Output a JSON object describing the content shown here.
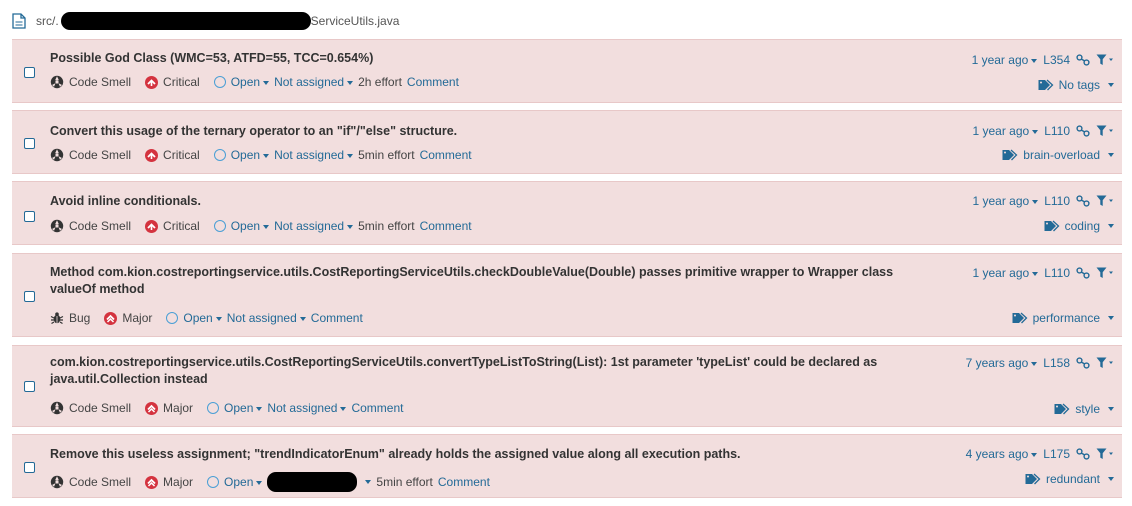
{
  "file": {
    "prefix": "src/.",
    "suffix": "ServiceUtils.java"
  },
  "issues": [
    {
      "title": "Possible God Class (WMC=53, ATFD=55, TCC=0.654%)",
      "type": "Code Smell",
      "severity": "Critical",
      "status": "Open",
      "assignee": "Not assigned",
      "effort": "2h effort",
      "comment": "Comment",
      "age": "1 year ago",
      "line": "L354",
      "tag": "No tags"
    },
    {
      "title": "Convert this usage of the ternary operator to an \"if\"/\"else\" structure.",
      "type": "Code Smell",
      "severity": "Critical",
      "status": "Open",
      "assignee": "Not assigned",
      "effort": "5min effort",
      "comment": "Comment",
      "age": "1 year ago",
      "line": "L110",
      "tag": "brain-overload"
    },
    {
      "title": "Avoid inline conditionals.",
      "type": "Code Smell",
      "severity": "Critical",
      "status": "Open",
      "assignee": "Not assigned",
      "effort": "5min effort",
      "comment": "Comment",
      "age": "1 year ago",
      "line": "L110",
      "tag": "coding"
    },
    {
      "title": "Method com.kion.costreportingservice.utils.CostReportingServiceUtils.checkDoubleValue(Double) passes primitive wrapper to Wrapper class valueOf method",
      "type": "Bug",
      "severity": "Major",
      "status": "Open",
      "assignee": "Not assigned",
      "effort": "",
      "comment": "Comment",
      "age": "1 year ago",
      "line": "L110",
      "tag": "performance"
    },
    {
      "title": "com.kion.costreportingservice.utils.CostReportingServiceUtils.convertTypeListToString(List): 1st parameter 'typeList' could be declared as java.util.Collection instead",
      "type": "Code Smell",
      "severity": "Major",
      "status": "Open",
      "assignee": "Not assigned",
      "effort": "",
      "comment": "Comment",
      "age": "7 years ago",
      "line": "L158",
      "tag": "style"
    },
    {
      "title": "Remove this useless assignment; \"trendIndicatorEnum\" already holds the assigned value along all execution paths.",
      "type": "Code Smell",
      "severity": "Major",
      "status": "Open",
      "assignee": "",
      "effort": "5min effort",
      "comment": "Comment",
      "age": "4 years ago",
      "line": "L175",
      "tag": "redundant"
    }
  ],
  "colors": {
    "link": "#236a97",
    "row_bg": "#f2dede",
    "critical": "#d4333f",
    "open": "#4b9fd5"
  }
}
